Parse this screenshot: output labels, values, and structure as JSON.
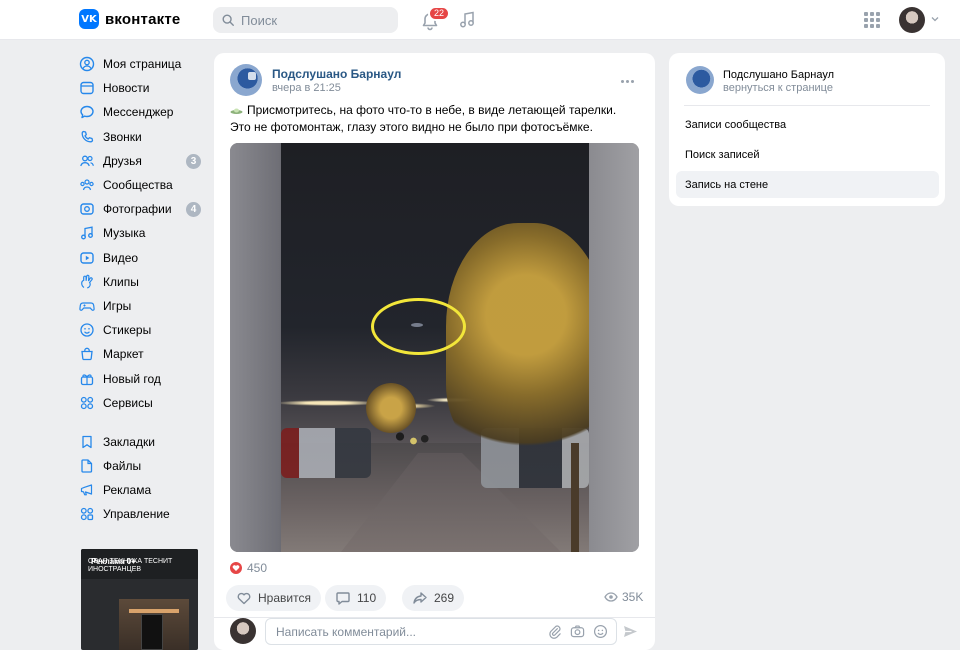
{
  "header": {
    "logo_mark": "VK",
    "logo_text": "вконтакте",
    "search_placeholder": "Поиск",
    "notifications_count": "22",
    "brand_color": "#0077ff"
  },
  "sidebar": {
    "items": [
      {
        "label": "Моя страница",
        "icon": "user-icon"
      },
      {
        "label": "Новости",
        "icon": "news-icon"
      },
      {
        "label": "Мессенджер",
        "icon": "message-icon"
      },
      {
        "label": "Звонки",
        "icon": "phone-icon"
      },
      {
        "label": "Друзья",
        "icon": "friends-icon",
        "badge": "3"
      },
      {
        "label": "Сообщества",
        "icon": "communities-icon"
      },
      {
        "label": "Фотографии",
        "icon": "photo-icon",
        "badge": "4"
      },
      {
        "label": "Музыка",
        "icon": "music-icon"
      },
      {
        "label": "Видео",
        "icon": "video-icon"
      },
      {
        "label": "Клипы",
        "icon": "clips-icon"
      },
      {
        "label": "Игры",
        "icon": "games-icon"
      },
      {
        "label": "Стикеры",
        "icon": "stickers-icon"
      },
      {
        "label": "Маркет",
        "icon": "market-icon"
      },
      {
        "label": "Новый год",
        "icon": "gift-icon"
      },
      {
        "label": "Сервисы",
        "icon": "services-icon"
      }
    ],
    "items2": [
      {
        "label": "Закладки",
        "icon": "bookmark-icon"
      },
      {
        "label": "Файлы",
        "icon": "file-icon"
      },
      {
        "label": "Реклама",
        "icon": "ads-icon"
      },
      {
        "label": "Управление",
        "icon": "manage-icon"
      }
    ],
    "ad": {
      "label": "Реклама 0+",
      "text": "ОВАЯ ТЕХНИКА ТЕСНИТ ИНОСТРАНЦЕВ"
    }
  },
  "post": {
    "author": "Подслушано Барнаул",
    "time": "вчера в 21:25",
    "text": "Присмотритесь, на фото что-то в небе, в виде летающей тарелки. Это не фотомонтаж, глазу этого видно не было при фотосъёмке.",
    "likes_count": "450",
    "like_label": "Нравится",
    "comments_count": "110",
    "shares_count": "269",
    "views_count": "35K",
    "comment_placeholder": "Написать комментарий..."
  },
  "right_panel": {
    "community": "Подслушано Барнаул",
    "back_label": "вернуться к странице",
    "items": [
      "Записи сообщества",
      "Поиск записей",
      "Запись на стене"
    ],
    "active_index": 2
  }
}
